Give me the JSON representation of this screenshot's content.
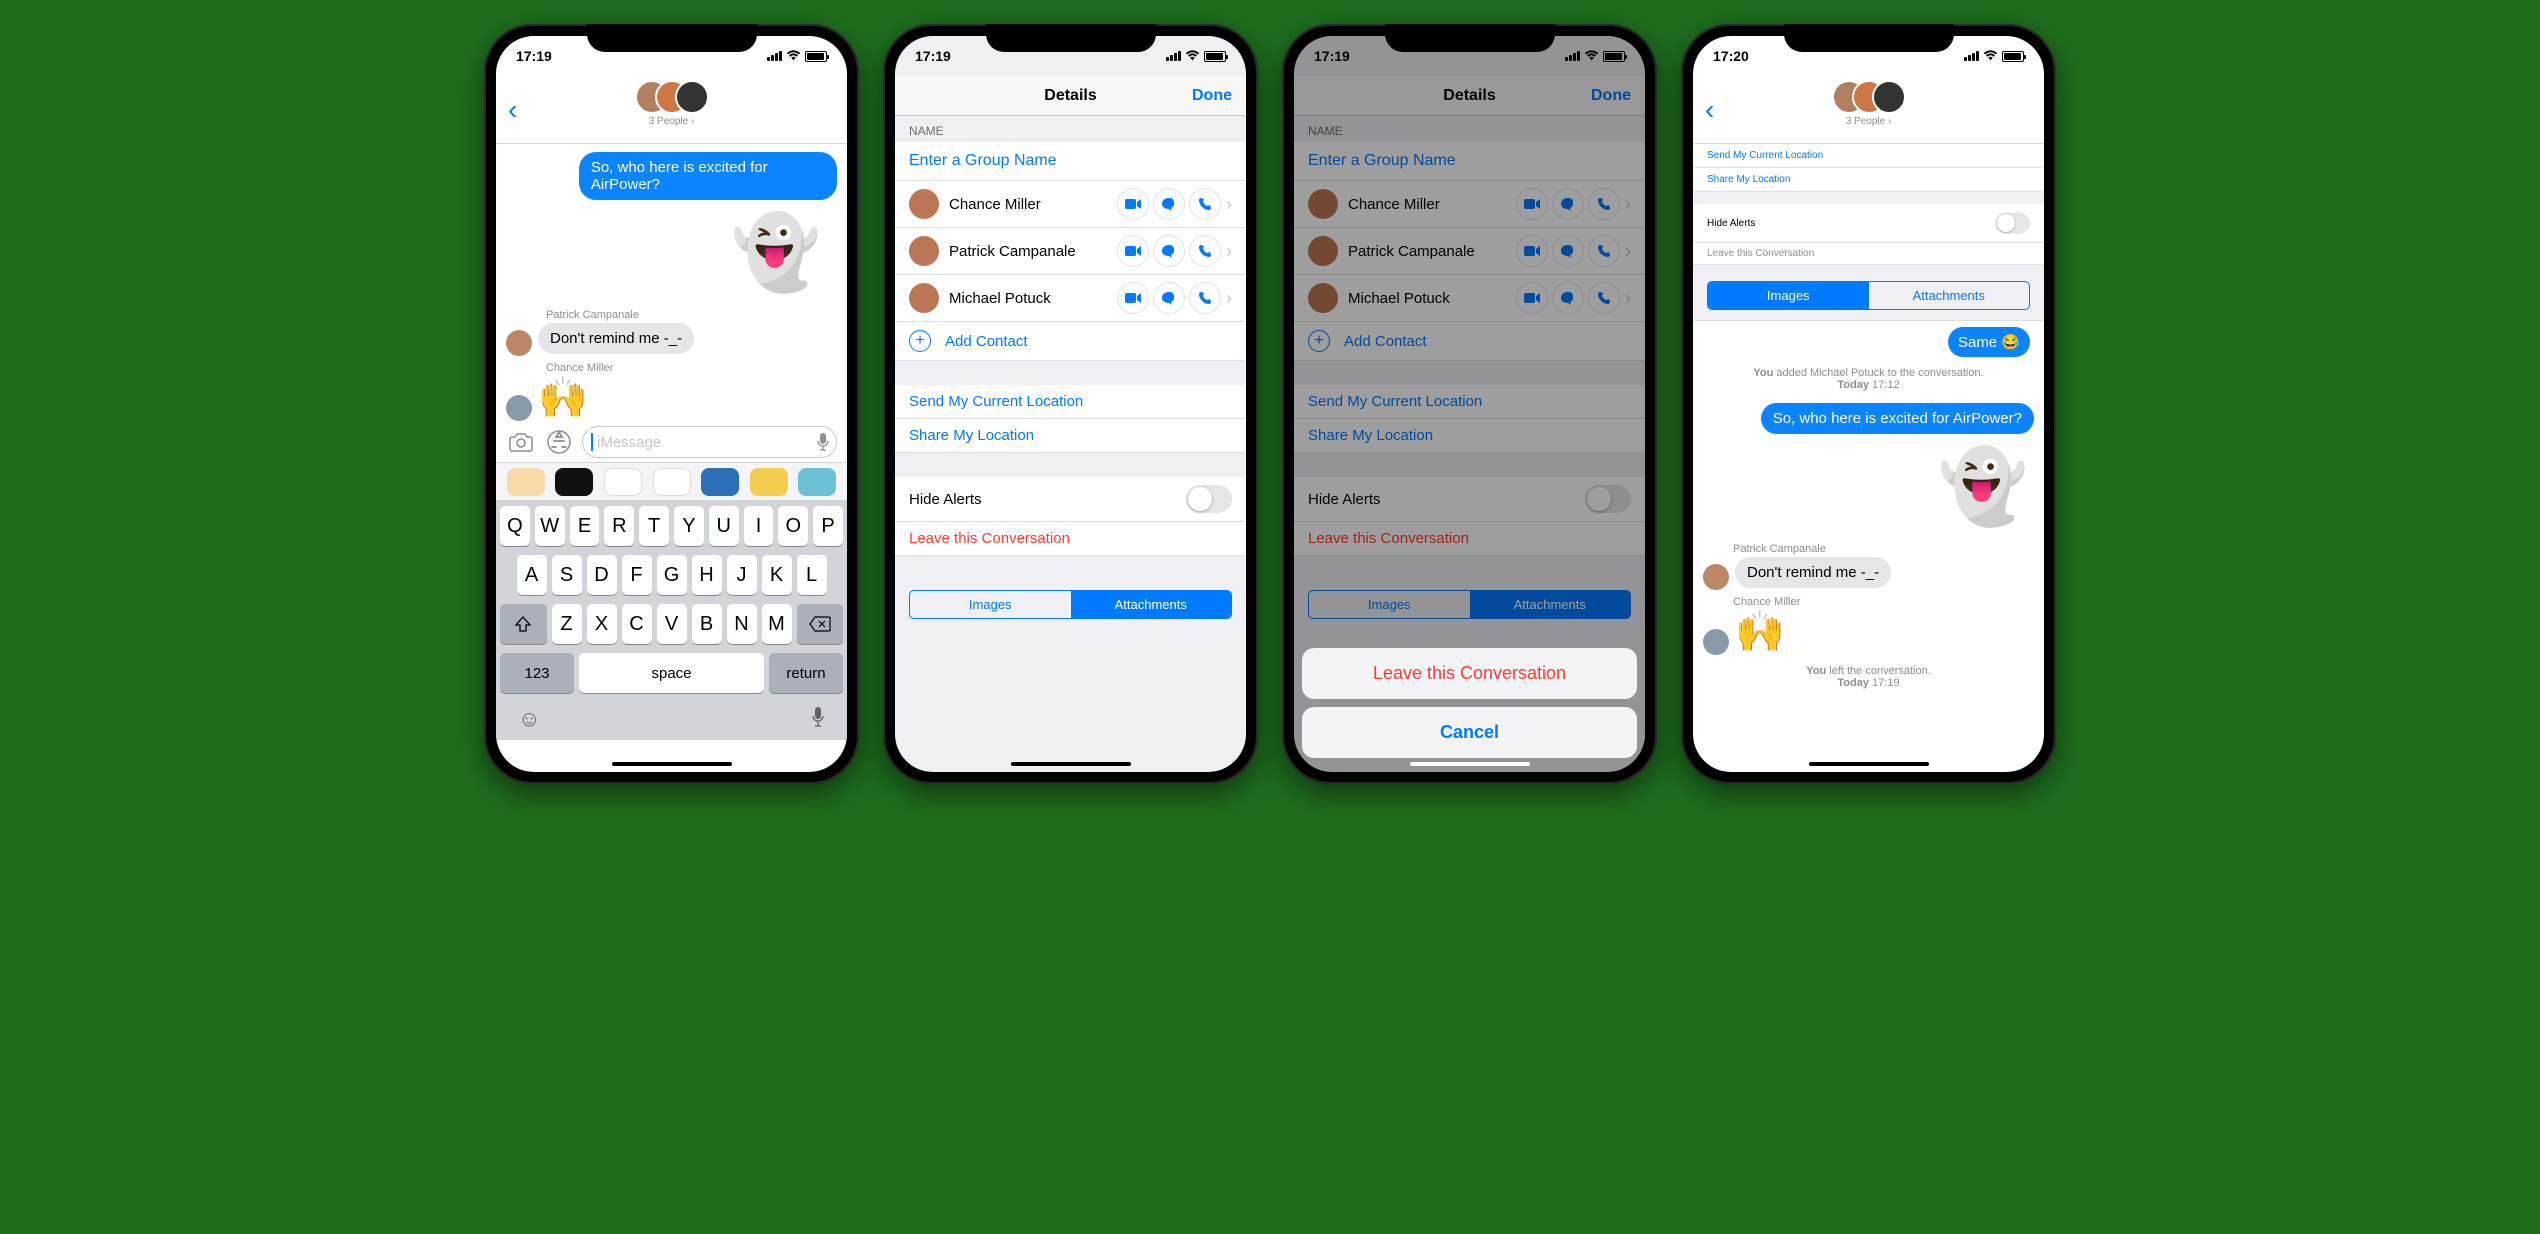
{
  "status": {
    "time_a": "17:19",
    "time_b": "17:20"
  },
  "conv": {
    "subtitle": "3 People ›",
    "out_msg": "So, who here is excited for AirPower?",
    "ghost": "👻",
    "sender1": "Patrick Campanale",
    "in_msg": "Don't remind me -_-",
    "sender2": "Chance Miller",
    "emoji2": "🙌",
    "placeholder": "iMessage"
  },
  "keyboard": {
    "r1": [
      "Q",
      "W",
      "E",
      "R",
      "T",
      "Y",
      "U",
      "I",
      "O",
      "P"
    ],
    "r2": [
      "A",
      "S",
      "D",
      "F",
      "G",
      "H",
      "J",
      "K",
      "L"
    ],
    "r3": [
      "Z",
      "X",
      "C",
      "V",
      "B",
      "N",
      "M"
    ],
    "num": "123",
    "space": "space",
    "ret": "return"
  },
  "details": {
    "title": "Details",
    "done": "Done",
    "name_header": "NAME",
    "name_placeholder": "Enter a Group Name",
    "contacts": [
      "Chance Miller",
      "Patrick Campanale",
      "Michael Potuck"
    ],
    "add": "Add Contact",
    "send_loc": "Send My Current Location",
    "share_loc": "Share My Location",
    "hide": "Hide Alerts",
    "leave": "Leave this Conversation",
    "seg_images": "Images",
    "seg_attach": "Attachments"
  },
  "sheet": {
    "leave": "Leave this Conversation",
    "cancel": "Cancel"
  },
  "screen4": {
    "same": "Same 😂",
    "added_pre": "You",
    "added_mid": " added Michael Potuck to the conversation.",
    "added_day": "Today",
    "added_time": "17:12",
    "left_pre": "You",
    "left_mid": " left the conversation.",
    "left_day": "Today",
    "left_time": "17:19"
  }
}
